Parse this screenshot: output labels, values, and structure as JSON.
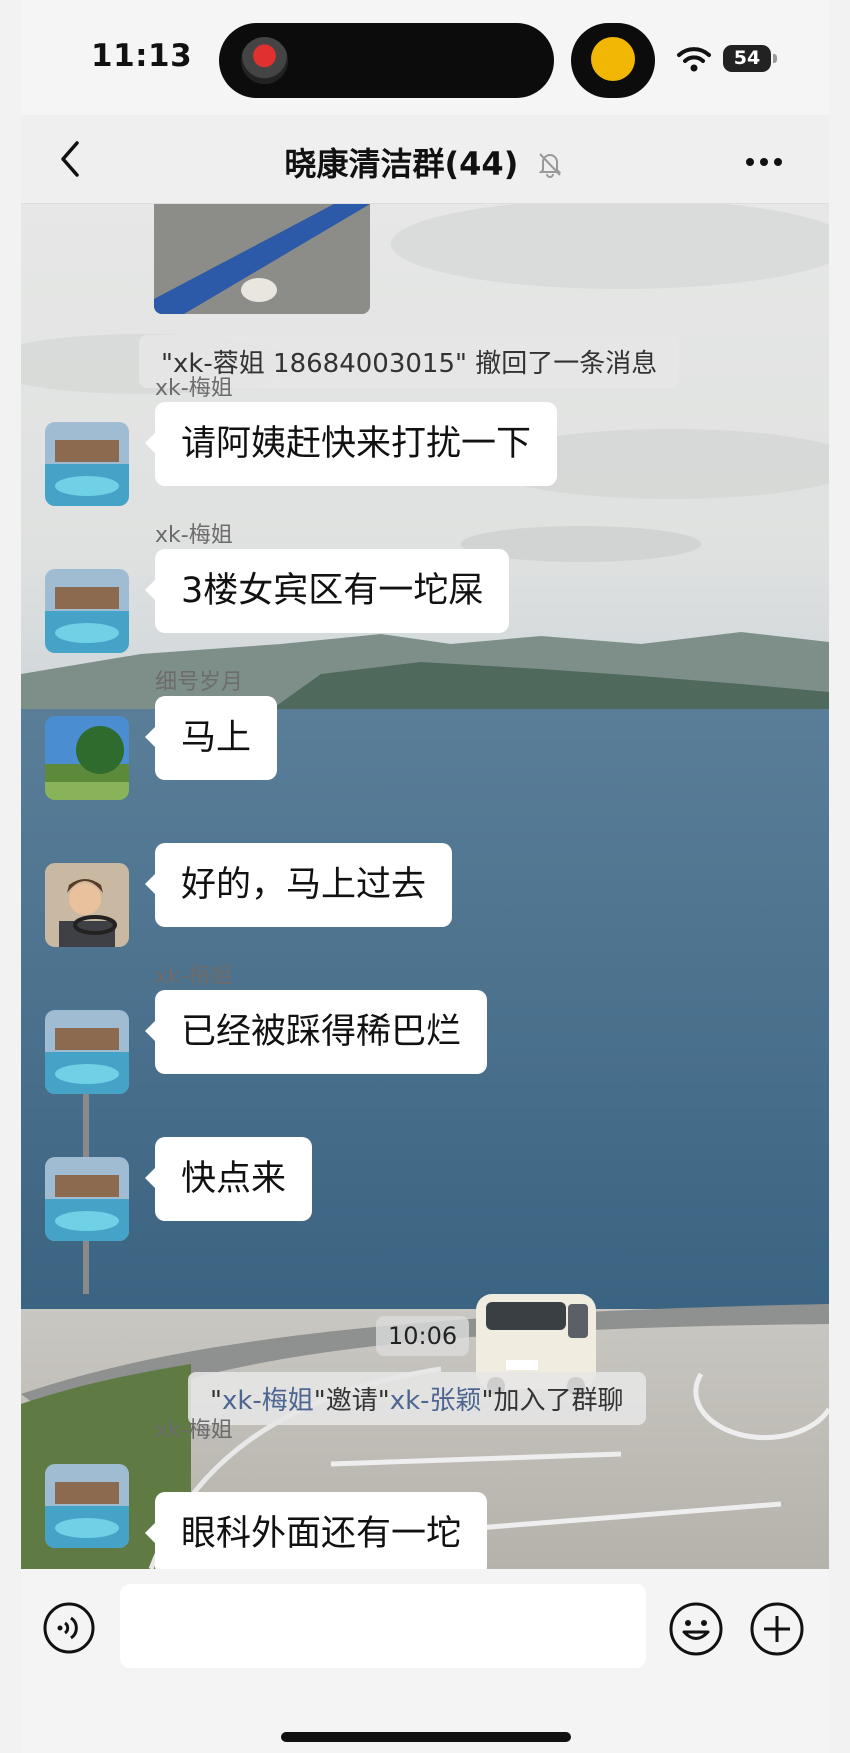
{
  "status_bar": {
    "time": "11:13",
    "battery": "54"
  },
  "nav": {
    "title": "晓康清洁群(44)"
  },
  "messages": [
    {
      "sender": "xk-梅姐",
      "text": "请阿姨赶快来打扰一下"
    },
    {
      "sender": "xk-梅姐",
      "text": "3楼女宾区有一坨屎"
    },
    {
      "sender": "细号岁月",
      "text": "马上"
    },
    {
      "sender": "",
      "text": "好的，马上过去"
    },
    {
      "sender": "xk-梅姐",
      "text": "已经被踩得稀巴烂"
    },
    {
      "sender": "",
      "text": "快点来"
    },
    {
      "sender": "xk-梅姐",
      "text": "眼科外面还有一坨"
    }
  ],
  "system": {
    "recall_notice": "\"xk-蓉姐 18684003015\" 撤回了一条消息",
    "timestamp": "10:06",
    "invite": {
      "q1": "\"",
      "inviter": "xk-梅姐",
      "mid": "\"邀请\"",
      "invitee": "xk-张颖",
      "end": "\"加入了群聊"
    }
  },
  "input": {
    "placeholder": ""
  },
  "colors": {
    "bubble": "#ffffff",
    "name_link": "#4d6691",
    "background_sea": "#3f6786"
  },
  "icons": [
    "back-icon",
    "mute-icon",
    "more-icon",
    "voice-icon",
    "emoji-icon",
    "add-icon",
    "wifi-icon",
    "battery-icon"
  ]
}
